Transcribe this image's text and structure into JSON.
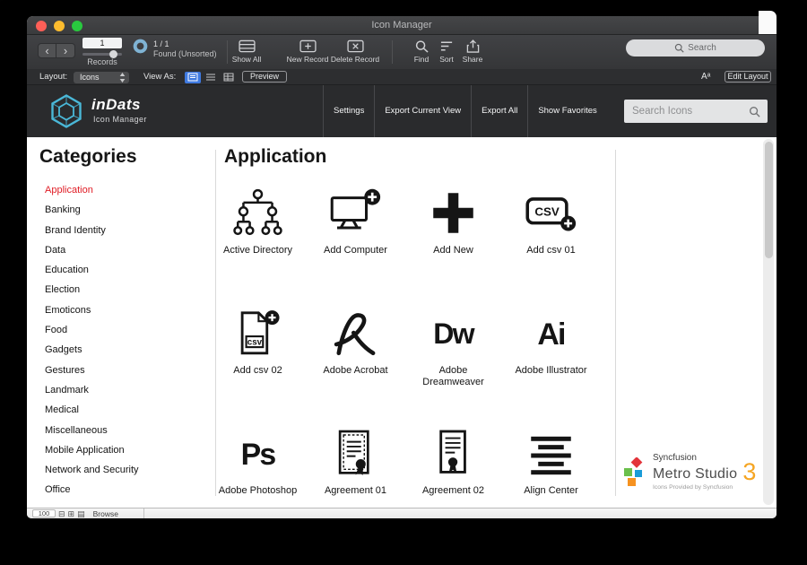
{
  "window": {
    "title": "Icon Manager",
    "toolbar": {
      "back_icon": "‹",
      "forward_icon": "›",
      "record_number": "1",
      "records_label": "Records",
      "found_count": "1 / 1",
      "found_status": "Found (Unsorted)",
      "show_all_label": "Show All",
      "new_record_label": "New Record",
      "delete_record_label": "Delete Record",
      "find_label": "Find",
      "sort_label": "Sort",
      "share_label": "Share",
      "search_placeholder": "Search"
    },
    "layout_bar": {
      "layout_label": "Layout:",
      "layout_value": "Icons",
      "view_as_label": "View As:",
      "preview_label": "Preview",
      "format_label": "Aᵃ",
      "edit_layout_label": "Edit Layout"
    },
    "status_bar": {
      "zoom_value": "100",
      "zoom_out_icon": "⊟",
      "zoom_in_icon": "⊞",
      "mode_icon": "▤",
      "mode_label": "Browse"
    }
  },
  "header": {
    "logo_title": "inDats",
    "logo_subtitle": "Icon Manager",
    "nav": [
      {
        "label": "Settings"
      },
      {
        "label": "Export Current View"
      },
      {
        "label": "Export All"
      },
      {
        "label": "Show Favorites"
      }
    ],
    "search_placeholder": "Search Icons"
  },
  "sidebar": {
    "heading": "Categories",
    "items": [
      {
        "label": "Application",
        "selected": true
      },
      {
        "label": "Banking"
      },
      {
        "label": "Brand Identity"
      },
      {
        "label": "Data"
      },
      {
        "label": "Education"
      },
      {
        "label": "Election"
      },
      {
        "label": "Emoticons"
      },
      {
        "label": "Food"
      },
      {
        "label": "Gadgets"
      },
      {
        "label": "Gestures"
      },
      {
        "label": "Landmark"
      },
      {
        "label": "Medical"
      },
      {
        "label": "Miscellaneous"
      },
      {
        "label": "Mobile Application"
      },
      {
        "label": "Network and Security"
      },
      {
        "label": "Office"
      }
    ]
  },
  "main": {
    "heading": "Application",
    "icons": [
      {
        "label": "Active Directory",
        "icon": "active-directory"
      },
      {
        "label": "Add Computer",
        "icon": "add-computer"
      },
      {
        "label": "Add New",
        "icon": "add-new"
      },
      {
        "label": "Add csv 01",
        "icon": "add-csv-01",
        "art_text": "CSV"
      },
      {
        "label": "Add csv 02",
        "icon": "add-csv-02",
        "art_text": "csv"
      },
      {
        "label": "Adobe Acrobat",
        "icon": "adobe-acrobat"
      },
      {
        "label": "Adobe Dreamweaver",
        "icon": "adobe-dreamweaver",
        "art_text": "Dw"
      },
      {
        "label": "Adobe Illustrator",
        "icon": "adobe-illustrator",
        "art_text": "Ai"
      },
      {
        "label": "Adobe Photoshop",
        "icon": "adobe-photoshop",
        "art_text": "Ps"
      },
      {
        "label": "Agreement 01",
        "icon": "agreement-01"
      },
      {
        "label": "Agreement 02",
        "icon": "agreement-02"
      },
      {
        "label": "Align Center",
        "icon": "align-center"
      }
    ]
  },
  "branding": {
    "company": "Syncfusion",
    "product": "Metro Studio",
    "version": "3",
    "tagline": "Icons Provided by Syncfusion"
  },
  "colors": {
    "selected_category": "#e01b24",
    "logo_accent": "#4ab8d8",
    "metro_version_orange": "#f5a523",
    "syncfusion_red": "#e3343b",
    "syncfusion_green": "#6abf4b",
    "syncfusion_blue": "#1a9cd8",
    "syncfusion_orange": "#f69220",
    "active_view_blue": "#3f7ae0",
    "traffic_close": "#ff5f57",
    "traffic_minimize": "#febc2e",
    "traffic_zoom": "#29c93f"
  }
}
